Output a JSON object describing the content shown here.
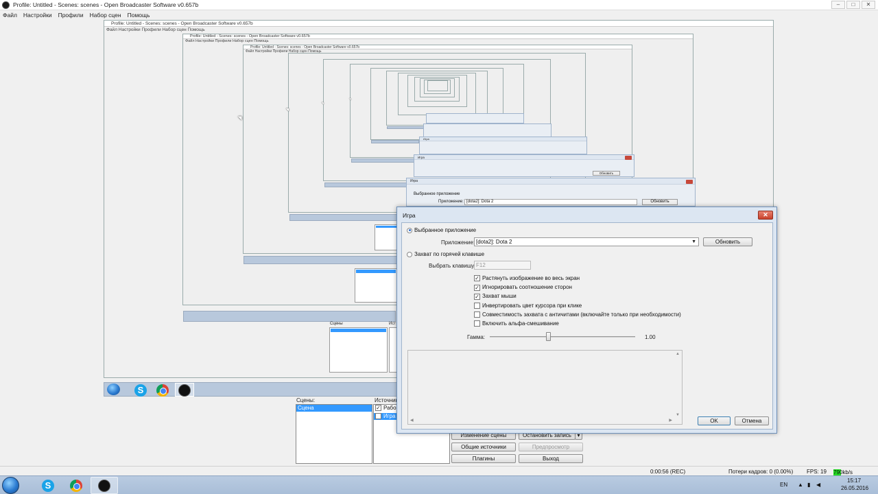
{
  "window": {
    "title": "Profile: Untitled - Scenes: scenes - Open Broadcaster Software v0.657b",
    "controls": [
      "–",
      "□",
      "✕"
    ]
  },
  "menu": [
    "Файл",
    "Настройки",
    "Профили",
    "Набор сцен",
    "Помощь"
  ],
  "nested": {
    "title": "Profile: Untitled - Scenes: scenes - Open Broadcaster Software v0.657b",
    "menu": "Файл   Настройки   Профили   Набор сцен   Помощь",
    "dialog_title": "Игра",
    "option_selected_app": "Выбранное приложение",
    "app_label": "Приложение:",
    "app_value": "[dota2]: Dota 2",
    "refresh": "Обновить",
    "scenes": "Сцены",
    "scene_item": "Сцена",
    "sources_short": "Ист"
  },
  "main": {
    "scenes_label": "Сцены:",
    "sources_label": "Источники",
    "scenes": [
      {
        "name": "Сцена",
        "selected": true
      }
    ],
    "sources": [
      {
        "name": "Рабо",
        "checked": true
      },
      {
        "name": "Игра",
        "checked": false,
        "selected": true
      }
    ],
    "buttons": {
      "edit_scene": "Изменение сцены",
      "stop_recording": "Остановить запись",
      "global_sources": "Общие источники",
      "preview": "Предпросмотр",
      "plugins": "Плагины",
      "exit": "Выход"
    }
  },
  "status": {
    "rec_time": "0:00:56 (REC)",
    "dropped_frames": "Потери кадров: 0 (0.00%)",
    "fps": "FPS: 19",
    "bitrate": "790kb/s"
  },
  "dialog": {
    "title": "Игра",
    "close": "✕",
    "option_selected_app": "Выбранное приложение",
    "app_label": "Приложение:",
    "app_value": "[dota2]: Dota 2",
    "refresh": "Обновить",
    "option_hotkey": "Захват по горячей клавише",
    "hotkey_label": "Выбрать клавишу",
    "hotkey_value": "F12",
    "checkboxes": [
      {
        "label": "Растянуть изображение во весь экран",
        "checked": true
      },
      {
        "label": "Игнорировать соотношение сторон",
        "checked": true
      },
      {
        "label": "Захват мыши",
        "checked": true
      },
      {
        "label": "Инвертировать цвет курсора при клике",
        "checked": false
      },
      {
        "label": "Совместимость захвата с античитами (включайте только при необходимости)",
        "checked": false
      },
      {
        "label": "Включить альфа-смешивание",
        "checked": false
      }
    ],
    "gamma_label": "Гамма:",
    "gamma_value": "1.00",
    "ok": "OK",
    "cancel": "Отмена"
  },
  "taskbar": {
    "apps": [
      "skype-icon",
      "chrome-icon",
      "obs-icon"
    ],
    "language": "EN",
    "time": "15:17",
    "date": "26.05.2016"
  },
  "colors": {
    "selection": "#3399ff",
    "taskbar": "#b0c4de",
    "bitrate_ok": "#22dd22",
    "close_red": "#c9422c"
  }
}
